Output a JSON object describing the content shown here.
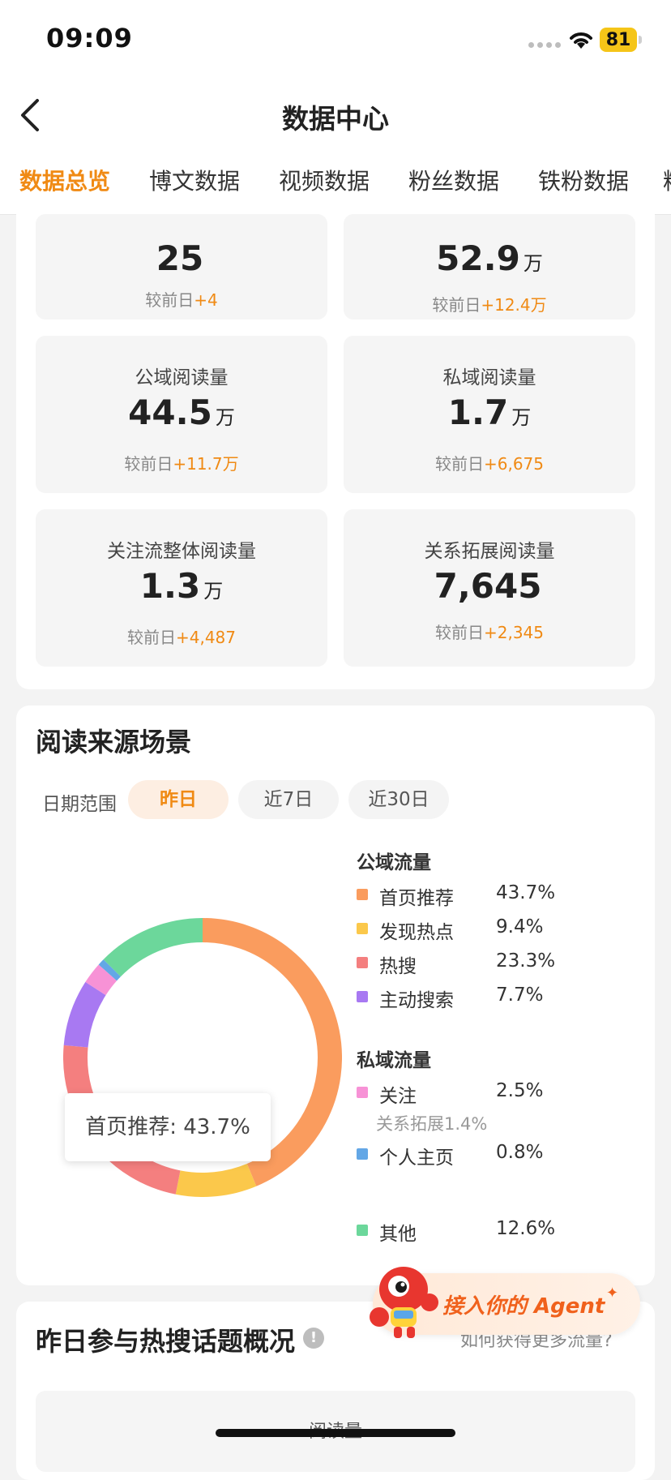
{
  "status": {
    "time": "09:09",
    "battery": "81"
  },
  "header": {
    "title": "数据中心"
  },
  "tabs": [
    {
      "label": "数据总览",
      "active": true
    },
    {
      "label": "博文数据"
    },
    {
      "label": "视频数据"
    },
    {
      "label": "粉丝数据"
    },
    {
      "label": "铁粉数据"
    },
    {
      "label": "粉"
    }
  ],
  "metrics": [
    {
      "label": "",
      "value": "25",
      "unit": "",
      "delta_prefix": "较前日",
      "delta": "+4"
    },
    {
      "label": "",
      "value": "52.9",
      "unit": "万",
      "delta_prefix": "较前日",
      "delta": "+12.4万"
    },
    {
      "label": "公域阅读量",
      "value": "44.5",
      "unit": "万",
      "delta_prefix": "较前日",
      "delta": "+11.7万"
    },
    {
      "label": "私域阅读量",
      "value": "1.7",
      "unit": "万",
      "delta_prefix": "较前日",
      "delta": "+6,675"
    },
    {
      "label": "关注流整体阅读量",
      "value": "1.3",
      "unit": "万",
      "delta_prefix": "较前日",
      "delta": "+4,487"
    },
    {
      "label": "关系拓展阅读量",
      "value": "7,645",
      "unit": "",
      "delta_prefix": "较前日",
      "delta": "+2,345"
    }
  ],
  "source": {
    "title": "阅读来源场景",
    "range_label": "日期范围",
    "ranges": [
      {
        "label": "昨日",
        "active": true
      },
      {
        "label": "近7日"
      },
      {
        "label": "近30日"
      }
    ],
    "tooltip": "首页推荐: 43.7%",
    "public_group": "公域流量",
    "private_group": "私域流量"
  },
  "chart_data": {
    "type": "pie",
    "donut": true,
    "slices": [
      {
        "name": "首页推荐",
        "value": 43.7,
        "pct": "43.7%",
        "color": "#fa9c5e",
        "group": "公域流量"
      },
      {
        "name": "发现热点",
        "value": 9.4,
        "pct": "9.4%",
        "color": "#fbc84b",
        "group": "公域流量"
      },
      {
        "name": "热搜",
        "value": 23.3,
        "pct": "23.3%",
        "color": "#f47f7f",
        "group": "公域流量"
      },
      {
        "name": "主动搜索",
        "value": 7.7,
        "pct": "7.7%",
        "color": "#a879f2",
        "group": "公域流量"
      },
      {
        "name": "关注",
        "value": 2.5,
        "pct": "2.5%",
        "color": "#f792d6",
        "group": "私域流量",
        "sub": "关系拓展1.4%"
      },
      {
        "name": "个人主页",
        "value": 0.8,
        "pct": "0.8%",
        "color": "#63a7e6",
        "group": "私域流量"
      },
      {
        "name": "其他",
        "value": 12.6,
        "pct": "12.6%",
        "color": "#6cd79b",
        "group": ""
      }
    ]
  },
  "hot": {
    "title": "昨日参与热搜话题概况",
    "link": "如何获得更多流量?",
    "inner_label": "阅读量"
  },
  "agent": {
    "label": "接入你的 Agent"
  }
}
